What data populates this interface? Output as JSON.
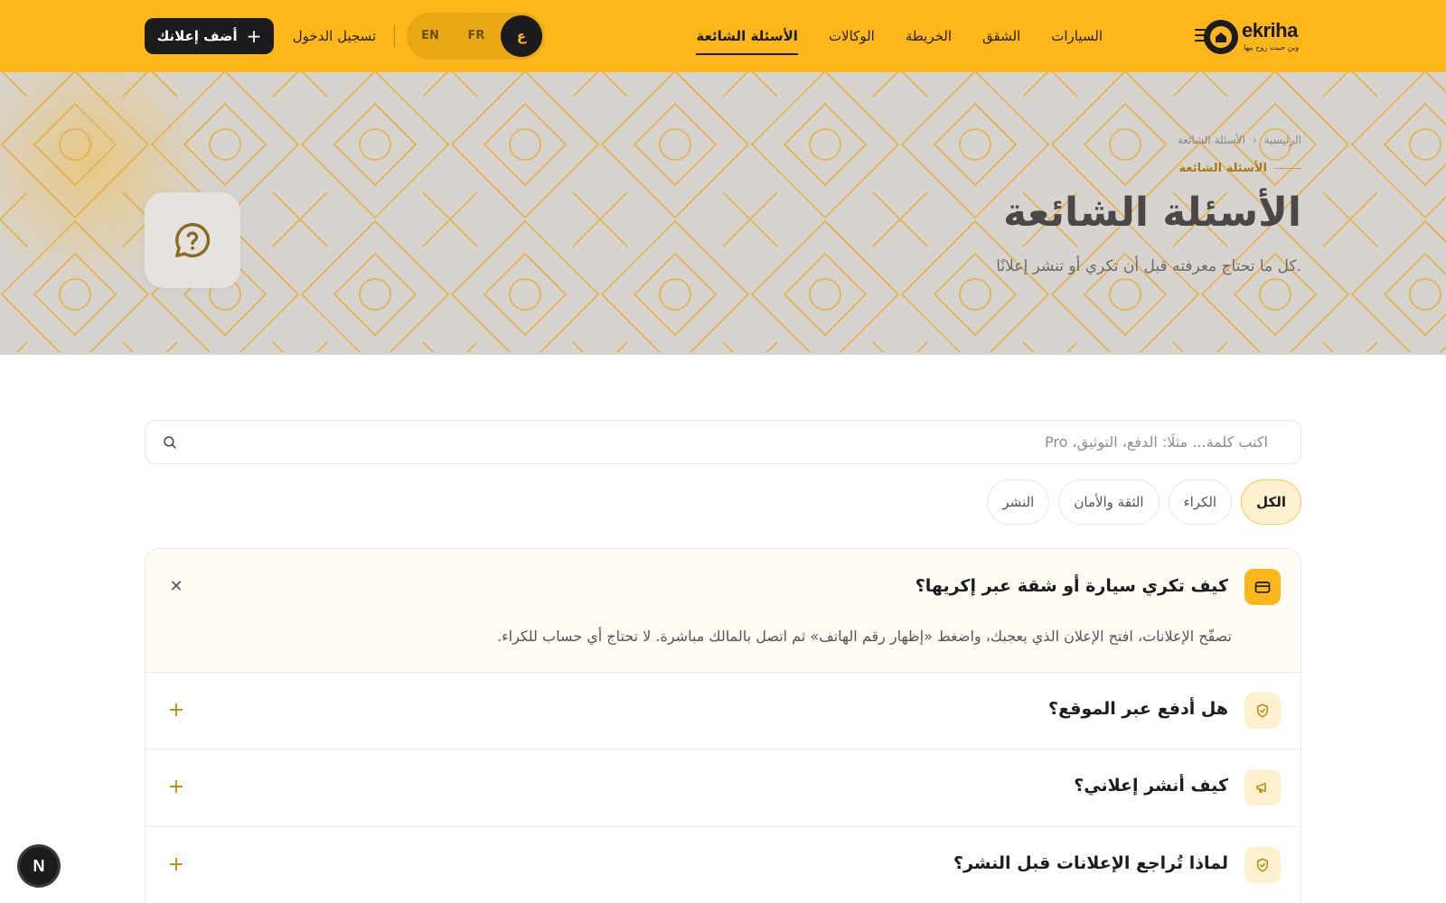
{
  "brand": {
    "name": "ekriha",
    "tagline": "وين حبيت روح بيها"
  },
  "nav": {
    "items": [
      {
        "label": "السيارات",
        "active": false
      },
      {
        "label": "الشقق",
        "active": false
      },
      {
        "label": "الخريطة",
        "active": false
      },
      {
        "label": "الوكالات",
        "active": false
      },
      {
        "label": "الأسئلة الشائعة",
        "active": true
      }
    ]
  },
  "lang": {
    "ar": "ع",
    "fr": "FR",
    "en": "EN"
  },
  "header": {
    "login": "تسجيل الدخول",
    "add_listing": "أضف إعلانك",
    "add_icon": "+"
  },
  "hero": {
    "breadcrumb": {
      "home": "الرئيسية",
      "separator": "›",
      "current": "الأسئلة الشائعة"
    },
    "eyebrow": "الأسئلة الشائعة",
    "title": "الأسئلة الشائعة",
    "subtitle": "كل ما تحتاج معرفته قبل أن تكري أو تنشر إعلانًا.",
    "badge_icon": "question-chat-icon"
  },
  "search": {
    "placeholder": "اكتب كلمة... مثلًا: الدفع، التوثيق، Pro",
    "value": ""
  },
  "filters": [
    {
      "label": "الكل",
      "active": true
    },
    {
      "label": "الكراء",
      "active": false
    },
    {
      "label": "الثقة والأمان",
      "active": false
    },
    {
      "label": "النشر",
      "active": false
    }
  ],
  "faq": [
    {
      "question": "كيف تكري سيارة أو شقة عبر إكريها؟",
      "answer": "تصفّح الإعلانات، افتح الإعلان الذي يعجبك، واضغط «إظهار رقم الهاتف» ثم اتصل بالمالك مباشرة. لا تحتاج أي حساب للكراء.",
      "open": true,
      "icon": "card-icon",
      "toggle": "✕"
    },
    {
      "question": "هل أدفع عبر الموقع؟",
      "open": false,
      "icon": "shield-icon",
      "toggle": "+"
    },
    {
      "question": "كيف أنشر إعلاني؟",
      "open": false,
      "icon": "megaphone-icon",
      "toggle": "+"
    },
    {
      "question": "لماذا تُراجع الإعلانات قبل النشر؟",
      "open": false,
      "icon": "shield-icon",
      "toggle": "+"
    }
  ],
  "fab": {
    "label": "N"
  },
  "colors": {
    "brand": "#FDB71A",
    "dark": "#1c1b1e",
    "chip_active_bg": "#fdf1cf"
  }
}
